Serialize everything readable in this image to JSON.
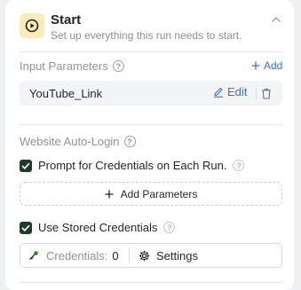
{
  "header": {
    "icon": "play-circle-icon",
    "title": "Start",
    "subtitle": "Set up everything this run needs to start.",
    "accent_bg": "#fbecb7"
  },
  "input_parameters": {
    "label": "Input Parameters",
    "add_label": "Add",
    "items": [
      {
        "name": "YouTube_Link",
        "edit_label": "Edit"
      }
    ]
  },
  "website_auto_login": {
    "label": "Website Auto-Login",
    "prompt_option": {
      "label": "Prompt for Credentials on Each Run.",
      "checked": true
    },
    "add_parameters_label": "Add Parameters",
    "stored_option": {
      "label": "Use Stored Credentials",
      "checked": true
    },
    "credentials_label": "Credentials:",
    "credentials_count": "0",
    "settings_label": "Settings"
  },
  "colors": {
    "link": "#3a6fe0",
    "checkbox": "#1f3b2c",
    "muted_text": "#8f949b"
  }
}
